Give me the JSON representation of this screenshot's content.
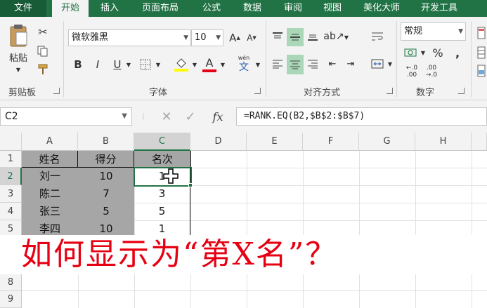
{
  "tabs": [
    "文件",
    "开始",
    "插入",
    "页面布局",
    "公式",
    "数据",
    "审阅",
    "视图",
    "美化大师",
    "开发工具"
  ],
  "ribbon": {
    "clipboard": {
      "paste_label": "粘贴",
      "group_label": "剪贴板"
    },
    "font": {
      "family": "微软雅黑",
      "size": "10",
      "group_label": "字体",
      "phonetic_label": "wén",
      "phonetic_char": "文",
      "font_color": "#e60012",
      "fill_color": "#ffff00"
    },
    "alignment": {
      "group_label": "对齐方式"
    },
    "number": {
      "format": "常规",
      "group_label": "数字"
    }
  },
  "formula_bar": {
    "name_box": "C2",
    "fx": "fx",
    "formula": "=RANK.EQ(B2,$B$2:$B$7)"
  },
  "columns": [
    "A",
    "B",
    "C",
    "D",
    "E",
    "F",
    "G",
    "H"
  ],
  "rows": [
    "1",
    "2",
    "3",
    "4",
    "5",
    "8",
    "9"
  ],
  "table": {
    "header": [
      "姓名",
      "得分",
      "名次"
    ],
    "rows": [
      [
        "刘一",
        "10",
        "1"
      ],
      [
        "陈二",
        "7",
        "3"
      ],
      [
        "张三",
        "5",
        "5"
      ],
      [
        "李四",
        "10",
        "1"
      ]
    ]
  },
  "overlay_caption": "如何显示为“第X名”？",
  "accent": "#217346"
}
